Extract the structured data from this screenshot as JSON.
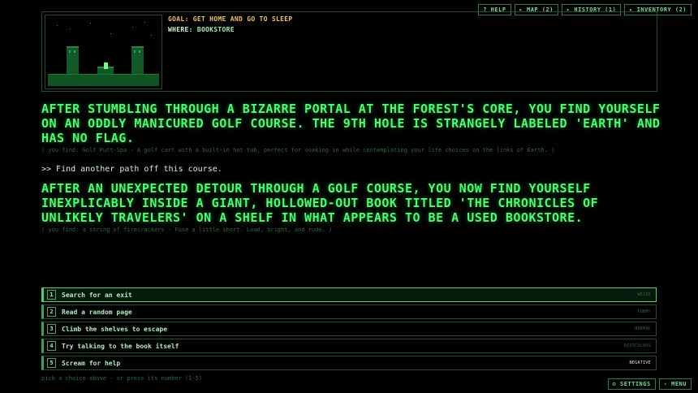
{
  "top_nav": {
    "help": "? HELP",
    "map": "▸ MAP (2)",
    "history": "▸ HISTORY (1)",
    "inventory": "▸ INVENTORY (2)"
  },
  "scene": {
    "goal": "GOAL: GET HOME AND GO TO SLEEP",
    "where_label": "WHERE:",
    "where_value": "BOOKSTORE"
  },
  "story": [
    {
      "narration": "After stumbling through a bizarre portal at the forest's core, you find yourself on an oddly manicured golf course. The 9th hole is strangely labeled 'Earth' and has no flag.",
      "found": "( you find: Golf Putt-Spa - A golf cart with a built-in hot tub, perfect for soaking in while contemplating your life choices on the links of Earth. )"
    },
    {
      "command": ">> Find another path off this course.",
      "narration": "After an unexpected detour through a golf course, you now find yourself inexplicably inside a giant, hollowed-out book titled 'The Chronicles of Unlikely Travelers' on a shelf in what appears to be a used bookstore.",
      "found": "( you find: a string of firecrackers - Fuse a little short. Loud, bright, and rude. )"
    }
  ],
  "choices": [
    {
      "number": "1",
      "label": "Search for an exit",
      "tag": "WEIRD"
    },
    {
      "number": "2",
      "label": "Read a random page",
      "tag": "FUNNY"
    },
    {
      "number": "3",
      "label": "Climb the shelves to escape",
      "tag": "NORMAL"
    },
    {
      "number": "4",
      "label": "Try talking to the book itself",
      "tag": "RIDICULOUS"
    },
    {
      "number": "5",
      "label": "Scream for help",
      "tag": "NEGATIVE"
    }
  ],
  "hint": "pick a choice above - or press its number (1-5)",
  "bottom_nav": {
    "settings": "⚙ SETTINGS",
    "menu": "‹ MENU"
  },
  "colors": {
    "text_green": "#39ff6a",
    "goal_amber": "#f0c25a",
    "border_green": "#1e4f2c"
  }
}
